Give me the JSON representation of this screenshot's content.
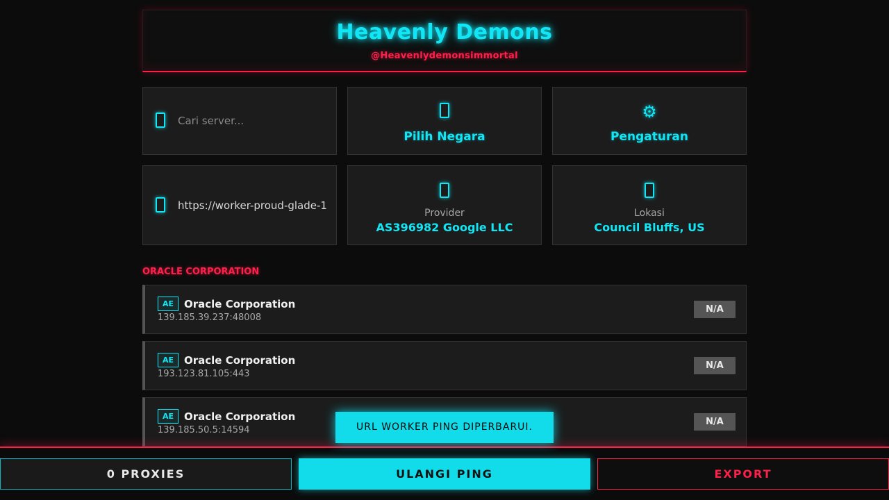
{
  "header": {
    "title": "Heavenly Demons",
    "subtitle": "@Heavenlydemonsimmortal"
  },
  "controls": {
    "search": {
      "placeholder": "Cari server...",
      "value": "",
      "icon": "box-glyph-icon"
    },
    "country": {
      "label": "Pilih Negara",
      "icon": "box-glyph-icon"
    },
    "settings": {
      "label": "Pengaturan",
      "icon": "gear-icon",
      "glyph": "⚙"
    },
    "worker_url": {
      "value": "https://worker-proud-glade-1",
      "icon": "box-glyph-icon"
    },
    "provider": {
      "caption": "Provider",
      "value": "AS396982 Google LLC",
      "icon": "box-glyph-icon"
    },
    "location": {
      "caption": "Lokasi",
      "value": "Council Bluffs, US",
      "icon": "box-glyph-icon"
    }
  },
  "section": {
    "title": "ORACLE CORPORATION"
  },
  "servers": [
    {
      "flag": "AE",
      "name": "Oracle Corporation",
      "address": "139.185.39.237:48008",
      "status": "N/A"
    },
    {
      "flag": "AE",
      "name": "Oracle Corporation",
      "address": "193.123.81.105:443",
      "status": "N/A"
    },
    {
      "flag": "AE",
      "name": "Oracle Corporation",
      "address": "139.185.50.5:14594",
      "status": "N/A"
    }
  ],
  "toast": {
    "message": "URL WORKER PING DIPERBARUI."
  },
  "bottom": {
    "proxies_label": "0 PROXIES",
    "ping_label": "ULANGI PING",
    "export_label": "EXPORT"
  },
  "colors": {
    "accent_cyan": "#12e6f5",
    "accent_red": "#ff1f4b",
    "background": "#0c0c0c",
    "card": "#1c1c1c"
  }
}
